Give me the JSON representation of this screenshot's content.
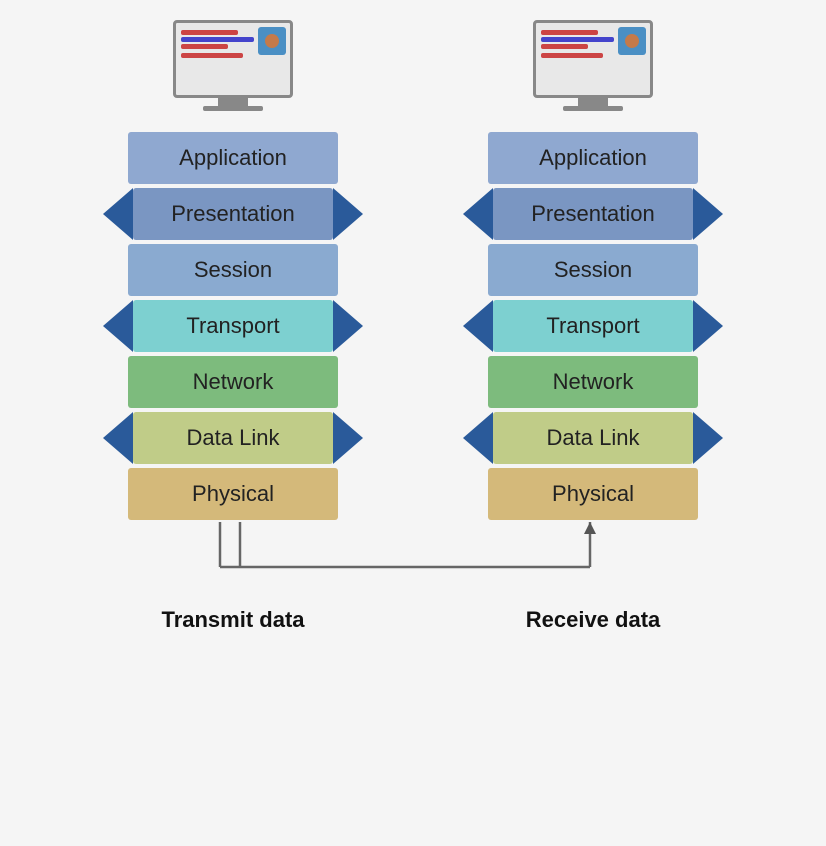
{
  "left": {
    "monitor_label": "Transmit data",
    "layers": [
      {
        "name": "Application",
        "color": "color-app",
        "arrow": "down"
      },
      {
        "name": "Presentation",
        "color": "color-pres",
        "arrow": "down"
      },
      {
        "name": "Session",
        "color": "color-sess",
        "arrow": "down"
      },
      {
        "name": "Transport",
        "color": "color-trans",
        "arrow": "down"
      },
      {
        "name": "Network",
        "color": "color-net",
        "arrow": "down"
      },
      {
        "name": "Data Link",
        "color": "color-data",
        "arrow": "down"
      },
      {
        "name": "Physical",
        "color": "color-phys",
        "arrow": "none"
      }
    ]
  },
  "right": {
    "monitor_label": "Receive data",
    "layers": [
      {
        "name": "Application",
        "color": "color-app",
        "arrow": "up"
      },
      {
        "name": "Presentation",
        "color": "color-pres",
        "arrow": "up"
      },
      {
        "name": "Session",
        "color": "color-sess",
        "arrow": "up"
      },
      {
        "name": "Transport",
        "color": "color-trans",
        "arrow": "up"
      },
      {
        "name": "Network",
        "color": "color-net",
        "arrow": "up"
      },
      {
        "name": "Data Link",
        "color": "color-data",
        "arrow": "up"
      },
      {
        "name": "Physical",
        "color": "color-phys",
        "arrow": "none"
      }
    ]
  }
}
